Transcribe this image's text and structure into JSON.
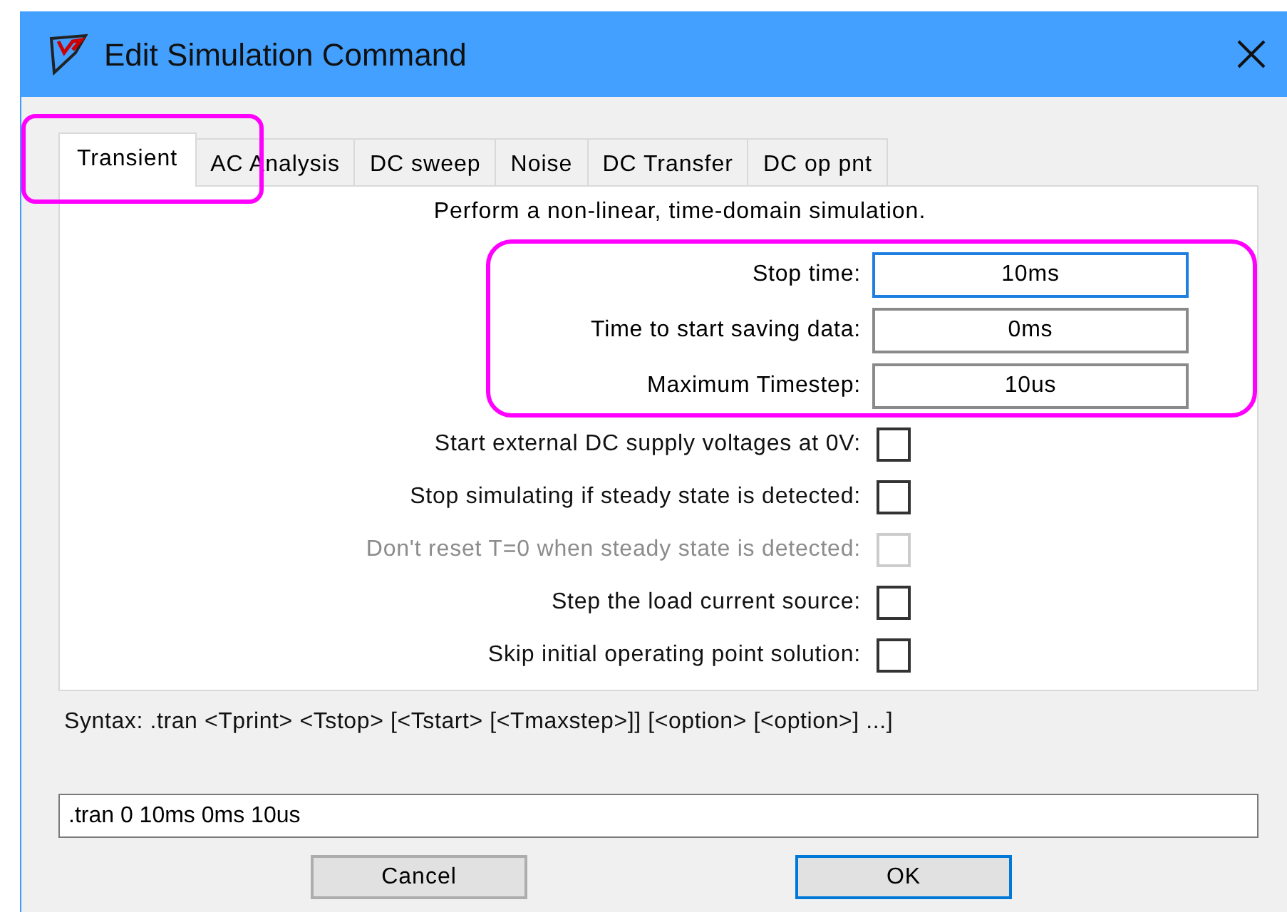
{
  "window": {
    "title": "Edit Simulation Command"
  },
  "tabs": [
    {
      "label": "Transient",
      "selected": true
    },
    {
      "label": "AC Analysis",
      "selected": false
    },
    {
      "label": "DC sweep",
      "selected": false
    },
    {
      "label": "Noise",
      "selected": false
    },
    {
      "label": "DC Transfer",
      "selected": false
    },
    {
      "label": "DC op pnt",
      "selected": false
    }
  ],
  "description": "Perform a non-linear, time-domain simulation.",
  "fields": [
    {
      "label": "Stop time:",
      "value": "10ms",
      "focused": true
    },
    {
      "label": "Time to start saving data:",
      "value": "0ms",
      "focused": false
    },
    {
      "label": "Maximum Timestep:",
      "value": "10us",
      "focused": false
    }
  ],
  "options": [
    {
      "label": "Start external DC supply voltages at 0V:",
      "checked": false,
      "disabled": false
    },
    {
      "label": "Stop simulating if steady state is detected:",
      "checked": false,
      "disabled": false
    },
    {
      "label": "Don't reset T=0 when steady state is detected:",
      "checked": false,
      "disabled": true
    },
    {
      "label": "Step the load current source:",
      "checked": false,
      "disabled": false
    },
    {
      "label": "Skip initial operating point solution:",
      "checked": false,
      "disabled": false
    }
  ],
  "syntax": "Syntax:  .tran <Tprint> <Tstop> [<Tstart> [<Tmaxstep>]] [<option> [<option>] ...]",
  "command": ".tran 0 10ms 0ms 10us",
  "buttons": [
    {
      "label": "Cancel",
      "default": false
    },
    {
      "label": "OK",
      "default": true
    }
  ]
}
